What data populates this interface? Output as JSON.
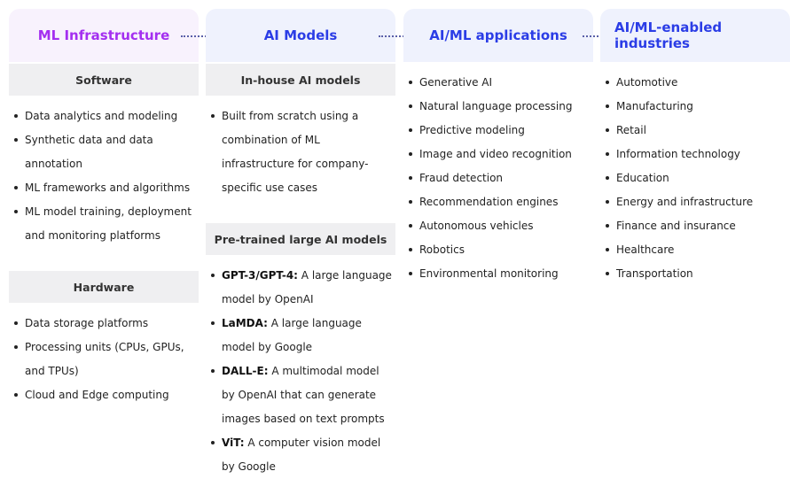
{
  "columns": [
    {
      "title": "ML Infrastructure",
      "sections": [
        {
          "heading": "Software",
          "items": [
            "Data analytics and modeling",
            "Synthetic data and data annotation",
            "ML frameworks and algorithms",
            "ML model training, deployment and monitoring platforms"
          ]
        },
        {
          "heading": "Hardware",
          "items": [
            "Data storage platforms",
            "Processing units (CPUs, GPUs, and TPUs)",
            "Cloud and Edge computing"
          ]
        }
      ]
    },
    {
      "title": "AI Models",
      "sections": [
        {
          "heading": "In-house AI models",
          "items": [
            "Built from scratch using a combination of ML infrastructure for company-specific use cases"
          ]
        },
        {
          "heading": "Pre-trained large AI models",
          "items": [
            {
              "term": "GPT-3/GPT-4:",
              "desc": " A large language model by OpenAI"
            },
            {
              "term": "LaMDA:",
              "desc": " A large language model by Google"
            },
            {
              "term": "DALL-E:",
              "desc": " A multimodal model by OpenAI that can generate images based on text prompts"
            },
            {
              "term": "ViT:",
              "desc": " A computer vision model by Google"
            }
          ]
        }
      ]
    },
    {
      "title": "AI/ML applications",
      "items": [
        "Generative AI",
        "Natural language processing",
        "Predictive modeling",
        "Image and video recognition",
        "Fraud detection",
        "Recommendation engines",
        "Autonomous vehicles",
        "Robotics",
        "Environmental monitoring"
      ]
    },
    {
      "title": "AI/ML-enabled industries",
      "items": [
        "Automotive",
        "Manufacturing",
        "Retail",
        "Information technology",
        "Education",
        "Energy and infrastructure",
        "Finance and insurance",
        "Healthcare",
        "Transportation"
      ]
    }
  ],
  "colors": {
    "infra_title": "#a42ff0",
    "title_blue": "#2b3de6",
    "infra_bg": "#f8f2fd",
    "blue_bg": "#eff2fd",
    "sub_bg": "#efeff1"
  }
}
